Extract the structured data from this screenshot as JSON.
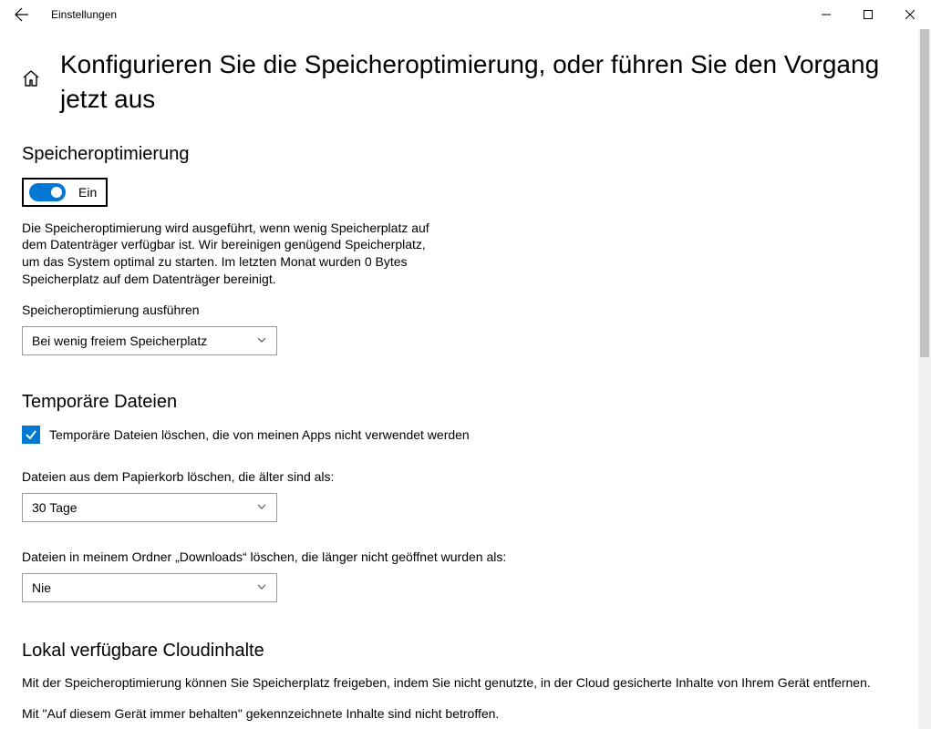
{
  "window": {
    "title": "Einstellungen"
  },
  "page": {
    "title": "Konfigurieren Sie die Speicheroptimierung, oder führen Sie den Vorgang jetzt aus"
  },
  "storage_sense": {
    "heading": "Speicheroptimierung",
    "toggle_state": "Ein",
    "description": "Die Speicheroptimierung wird ausgeführt, wenn wenig Speicherplatz auf dem Datenträger verfügbar ist. Wir bereinigen genügend Speicherplatz, um das System optimal zu starten. Im letzten Monat wurden 0 Bytes Speicherplatz auf dem Datenträger bereinigt.",
    "run_label": "Speicheroptimierung ausführen",
    "run_value": "Bei wenig freiem Speicherplatz"
  },
  "temp": {
    "heading": "Temporäre Dateien",
    "checkbox_label": "Temporäre Dateien löschen, die von meinen Apps nicht verwendet werden",
    "recycle_label": "Dateien aus dem Papierkorb löschen, die älter sind als:",
    "recycle_value": "30 Tage",
    "downloads_label": "Dateien in meinem Ordner „Downloads“ löschen, die länger nicht geöffnet wurden als:",
    "downloads_value": "Nie"
  },
  "cloud": {
    "heading": "Lokal verfügbare Cloudinhalte",
    "p1": "Mit der Speicheroptimierung können Sie Speicherplatz freigeben, indem Sie nicht genutzte, in der Cloud gesicherte Inhalte von Ihrem Gerät entfernen.",
    "p2": "Mit  \"Auf diesem Gerät immer behalten\" gekennzeichnete Inhalte sind nicht betroffen."
  }
}
